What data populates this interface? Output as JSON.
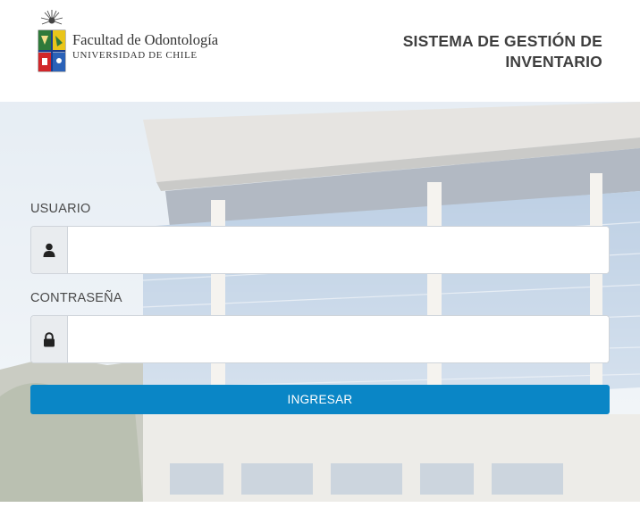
{
  "header": {
    "logo": {
      "icon": "university-crest-icon",
      "faculty": "Facultad de Odontología",
      "university": "UNIVERSIDAD DE CHILE"
    },
    "app_title_line1": "SISTEMA DE GESTIÓN DE",
    "app_title_line2": "INVENTARIO"
  },
  "login": {
    "username_label": "USUARIO",
    "username_icon": "user-icon",
    "username_value": "",
    "password_label": "CONTRASEÑA",
    "password_icon": "lock-icon",
    "password_value": "",
    "submit_label": "INGRESAR"
  },
  "colors": {
    "primary_button": "#0a86c6",
    "title_text": "#3f3f3f",
    "addon_background": "#e9ecef"
  }
}
